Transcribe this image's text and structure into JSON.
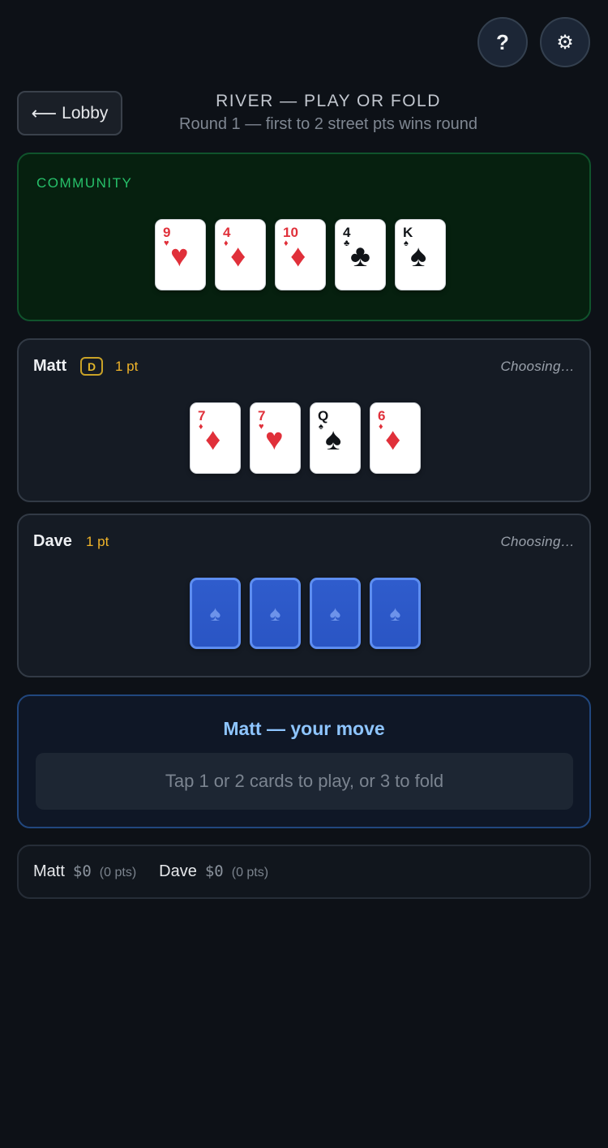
{
  "header": {
    "help_label": "?",
    "settings_label": "⚙",
    "lobby_label": "Lobby",
    "phase": "RIVER — PLAY OR FOLD",
    "round": "Round 1 — first to 2 street pts wins round"
  },
  "community": {
    "label": "COMMUNITY",
    "cards": [
      {
        "rank": "9",
        "suit": "♥",
        "color": "red"
      },
      {
        "rank": "4",
        "suit": "♦",
        "color": "red"
      },
      {
        "rank": "10",
        "suit": "♦",
        "color": "red"
      },
      {
        "rank": "4",
        "suit": "♣",
        "color": "black"
      },
      {
        "rank": "K",
        "suit": "♠",
        "color": "black"
      }
    ]
  },
  "players": {
    "matt": {
      "name": "Matt",
      "dealer_badge": "D",
      "points": "1 pt",
      "status": "Choosing…",
      "cards": [
        {
          "rank": "7",
          "suit": "♦",
          "color": "red"
        },
        {
          "rank": "7",
          "suit": "♥",
          "color": "red"
        },
        {
          "rank": "Q",
          "suit": "♠",
          "color": "black"
        },
        {
          "rank": "6",
          "suit": "♦",
          "color": "red"
        }
      ]
    },
    "dave": {
      "name": "Dave",
      "points": "1 pt",
      "status": "Choosing…",
      "card_back_symbol": "♠",
      "hidden_card_count": 4
    }
  },
  "move": {
    "title": "Matt — your move",
    "hint": "Tap 1 or 2 cards to play, or 3 to fold"
  },
  "scores": [
    {
      "name": "Matt",
      "money": "$0",
      "pts": "(0 pts)"
    },
    {
      "name": "Dave",
      "money": "$0",
      "pts": "(0 pts)"
    }
  ],
  "colors": {
    "background": "#0d1117",
    "community_bg": "#06200f",
    "accent_green": "#27c06a",
    "points_gold": "#f0b429",
    "move_title_blue": "#8ec5ff",
    "card_red": "#e0303a",
    "card_back_blue": "#2f5ccc"
  }
}
